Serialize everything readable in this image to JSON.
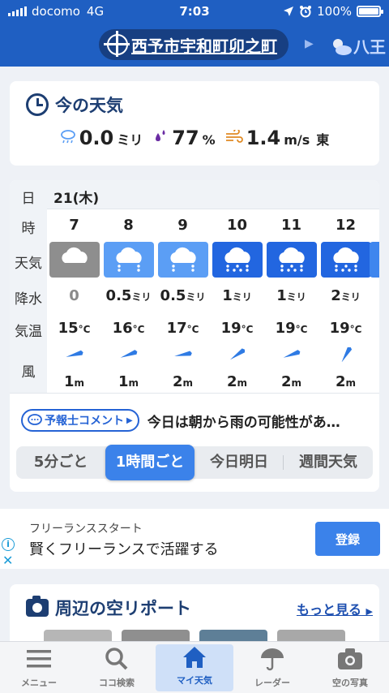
{
  "status_bar": {
    "carrier": "docomo",
    "network": "4G",
    "time": "7:03",
    "battery": "100%",
    "battery_level": 1.0
  },
  "location": {
    "current": "西予市宇和町卯之町",
    "next": "八王"
  },
  "now": {
    "title": "今の天気",
    "precip_value": "0.0",
    "precip_unit": "ミリ",
    "humidity_value": "77",
    "humidity_unit": "%",
    "wind_value": "1.4",
    "wind_unit": "m/s",
    "wind_dir": "東"
  },
  "forecast": {
    "row_labels": {
      "day": "日",
      "hour": "時",
      "weather": "天気",
      "precip": "降水",
      "temp": "気温",
      "wind": "風"
    },
    "day": "21(木)",
    "precip_unit": "ミリ",
    "temp_unit": "°C",
    "wind_unit": "m",
    "hours": [
      {
        "hour": "7",
        "weather": "cloudy",
        "precip": "0",
        "temp": "15",
        "wind_dir_deg": 75,
        "wind": "1"
      },
      {
        "hour": "8",
        "weather": "light-rain",
        "precip": "0.5",
        "temp": "16",
        "wind_dir_deg": 70,
        "wind": "1"
      },
      {
        "hour": "9",
        "weather": "light-rain",
        "precip": "0.5",
        "temp": "17",
        "wind_dir_deg": 80,
        "wind": "2"
      },
      {
        "hour": "10",
        "weather": "rain",
        "precip": "1",
        "temp": "19",
        "wind_dir_deg": 55,
        "wind": "2"
      },
      {
        "hour": "11",
        "weather": "rain",
        "precip": "1",
        "temp": "19",
        "wind_dir_deg": 70,
        "wind": "2"
      },
      {
        "hour": "12",
        "weather": "rain",
        "precip": "2",
        "temp": "19",
        "wind_dir_deg": 30,
        "wind": "2"
      }
    ],
    "weather_colors": {
      "cloudy": "#8e8e8e",
      "light-rain": "#5b9ef5",
      "rain": "#2266e0"
    },
    "comment_button": "予報士コメント",
    "comment_text": "今日は朝から雨の可能性があ…",
    "tabs": [
      "5分ごと",
      "1時間ごと",
      "今日明日",
      "週間天気"
    ],
    "active_tab": "1時間ごと"
  },
  "ad": {
    "sponsor": "フリーランススタート",
    "headline": "賢くフリーランスで活躍する",
    "button": "登録"
  },
  "sky_report": {
    "title": "周辺の空リポート",
    "more": "もっと見る"
  },
  "tab_bar": [
    {
      "label": "メニュー",
      "icon": "menu-icon"
    },
    {
      "label": "ココ検索",
      "icon": "search-icon"
    },
    {
      "label": "マイ天気",
      "icon": "home-icon"
    },
    {
      "label": "レーダー",
      "icon": "radar-umbrella-icon"
    },
    {
      "label": "空の写真",
      "icon": "camera-icon"
    }
  ],
  "active_tab_bar": "マイ天気",
  "colors": {
    "brand_blue": "#1f5fc2",
    "accent_blue": "#3b82ea",
    "title_navy": "#1d3e72"
  }
}
